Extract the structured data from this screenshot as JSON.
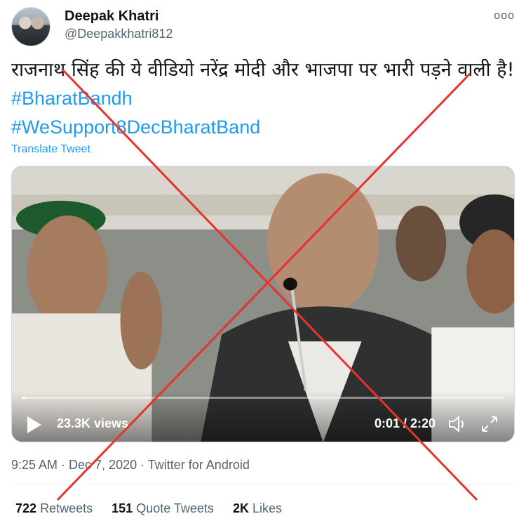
{
  "tweet": {
    "author": {
      "display_name": "Deepak Khatri",
      "handle": "@Deepakkhatri812"
    },
    "more_icon": "ooo",
    "text": "राजनाथ सिंह की ये वीडियो नरेंद्र मोदी और भाजपा पर भारी पड़ने वाली है!",
    "hashtags": [
      "#BharatBandh",
      "#WeSupport8DecBharatBand"
    ],
    "translate_label": "Translate Tweet",
    "video": {
      "views": "23.3K views",
      "time": "0:01 / 2:20",
      "progress": 0.007
    },
    "meta": "9:25 AM · Dec 7, 2020 · Twitter for Android",
    "stats": {
      "retweets_count": "722",
      "retweets_label": "Retweets",
      "quotes_count": "151",
      "quotes_label": "Quote Tweets",
      "likes_count": "2K",
      "likes_label": "Likes"
    }
  },
  "colors": {
    "link": "#1d9bf0",
    "overlay_cross": "#e8322d"
  },
  "icons": [
    "more-icon",
    "play-icon",
    "volume-icon",
    "fullscreen-icon"
  ]
}
